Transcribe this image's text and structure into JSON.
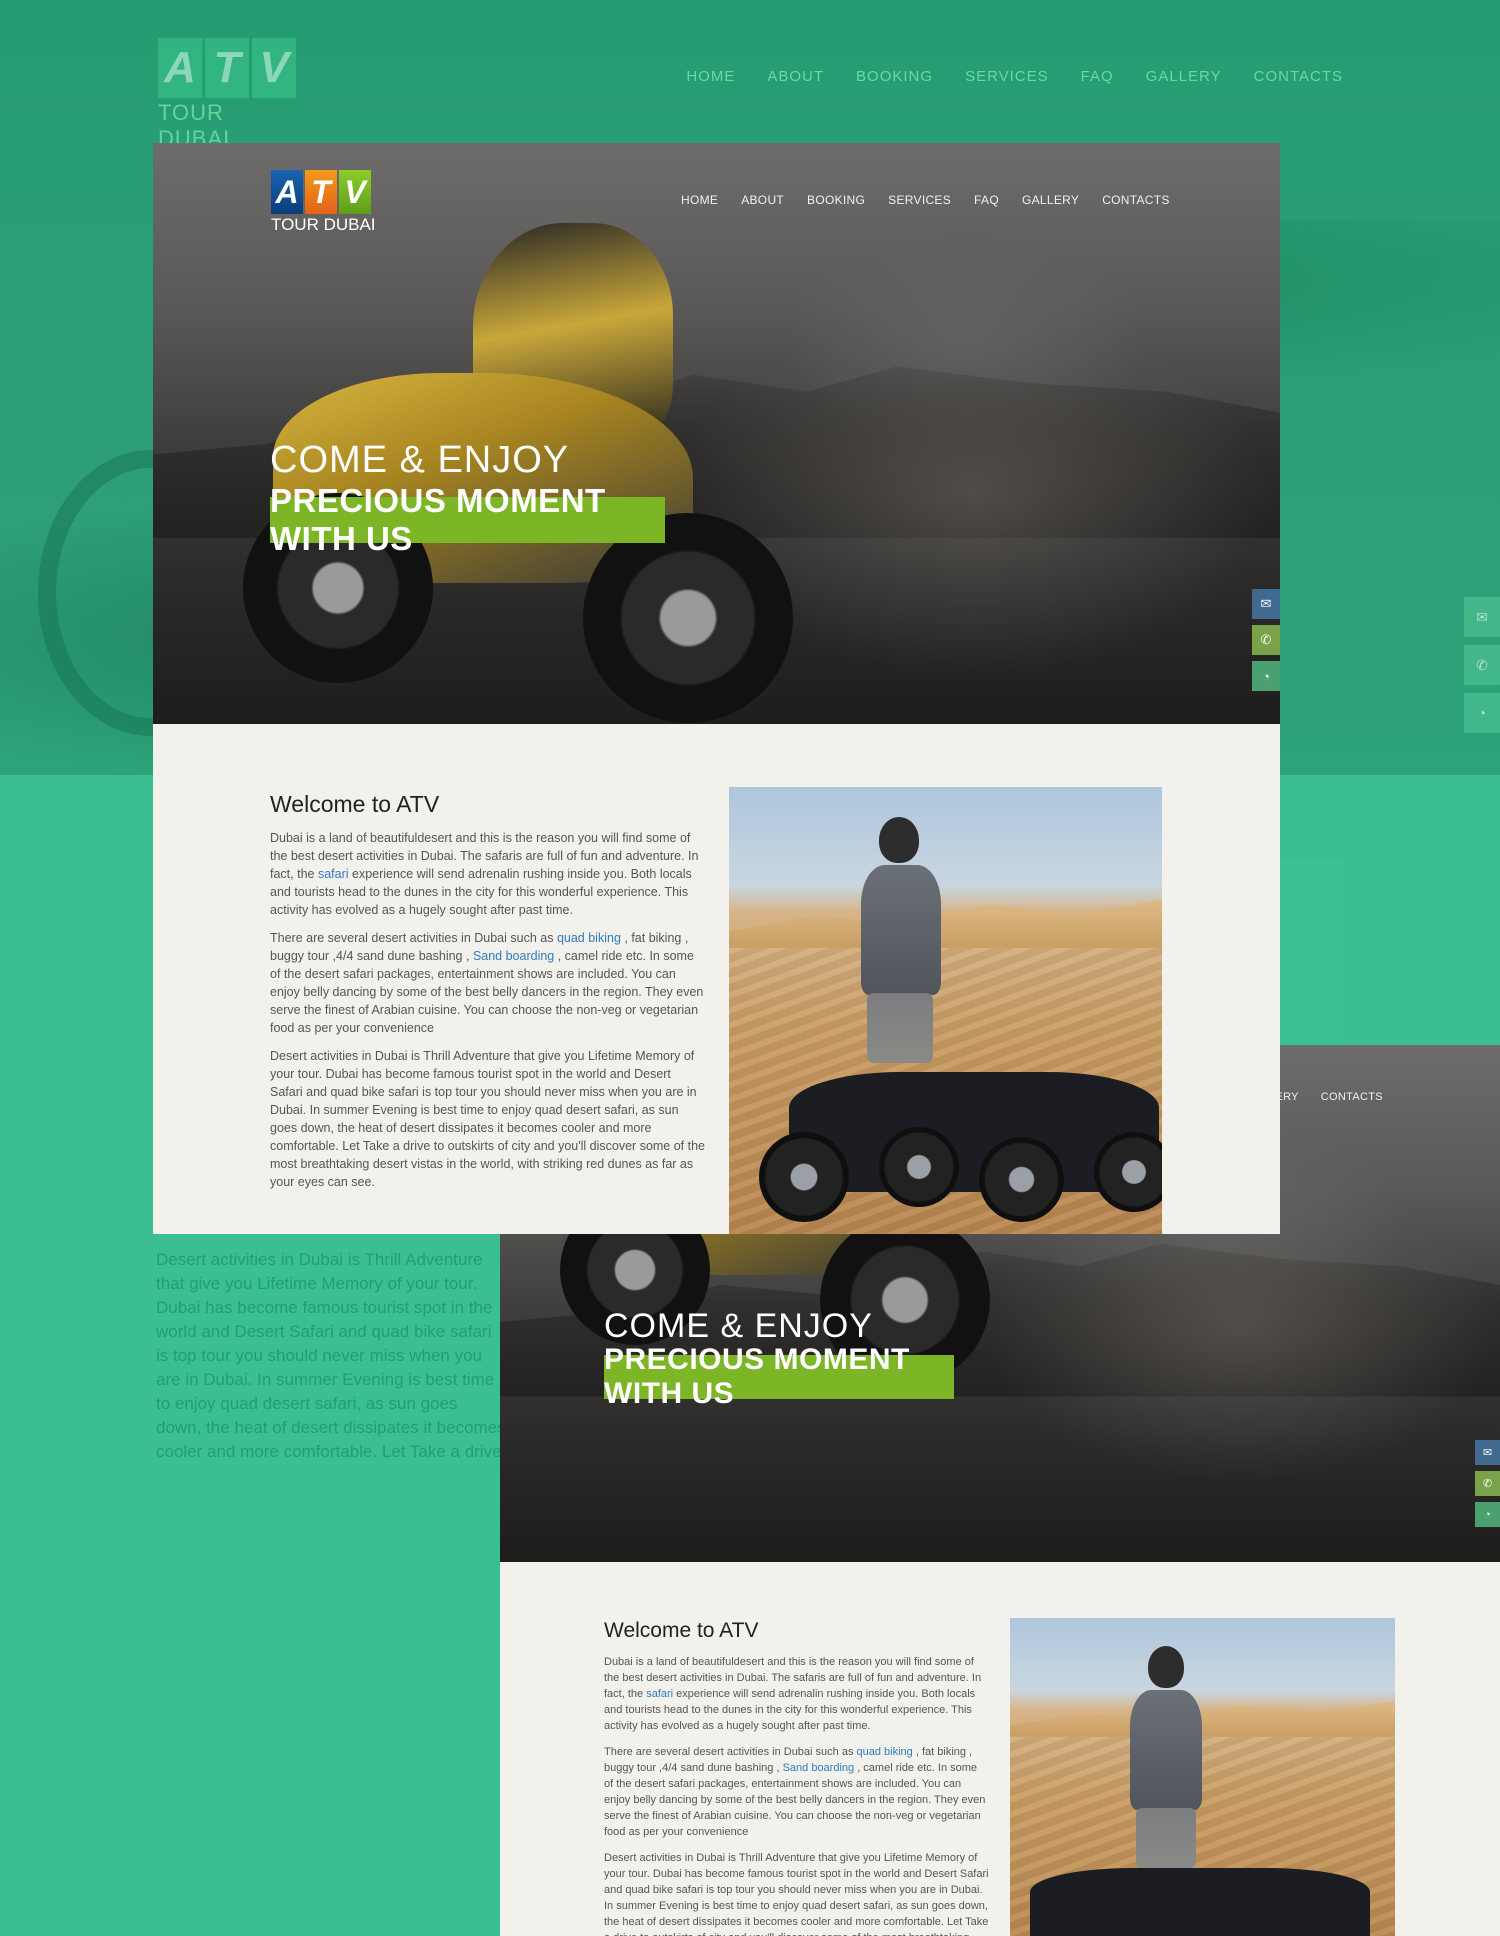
{
  "brand": {
    "letters": [
      "A",
      "T",
      "V"
    ],
    "name": "TOUR DUBAI"
  },
  "nav": {
    "items": [
      "HOME",
      "ABOUT",
      "BOOKING",
      "SERVICES",
      "FAQ",
      "GALLERY",
      "CONTACTS"
    ]
  },
  "nav_partial": {
    "gallery_fragment": "ALLERY",
    "contacts": "CONTACTS"
  },
  "hero": {
    "title": "COME & ENJOY",
    "badge": "PRECIOUS MOMENT WITH US"
  },
  "side_buttons": [
    {
      "icon": "envelope-icon",
      "glyph": "✉"
    },
    {
      "icon": "phone-icon",
      "glyph": "✆"
    },
    {
      "icon": "whatsapp-icon",
      "glyph": "◔"
    }
  ],
  "welcome": {
    "title": "Welcome to ATV",
    "p1_a": "Dubai is a land of beautifuldesert and this is the reason you will find some of the best desert activities in Dubai. The safaris are full of fun and adventure. In fact, the ",
    "p1_link": "safari",
    "p1_b": " experience will send adrenalin rushing inside you. Both locals and tourists head to the dunes in the city for this wonderful experience. This activity has evolved as a hugely sought after past time.",
    "p2_a": "There are several desert activities in Dubai such as ",
    "p2_link1": "quad biking",
    "p2_b": " , fat biking , buggy tour ,4/4 sand dune bashing , ",
    "p2_link2": "Sand boarding",
    "p2_c": " , camel ride etc. In some of the desert safari packages, entertainment shows are included. You can enjoy belly dancing by some of the best belly dancers in the region. They even serve the finest of Arabian cuisine. You can choose the non-veg or vegetarian food as per your convenience",
    "p3": "Desert activities in Dubai is Thrill Adventure that give you Lifetime Memory of your tour. Dubai has become famous tourist spot in the world and Desert Safari and quad bike safari is top tour you should never miss when you are in Dubai. In summer Evening is best time to enjoy quad desert safari, as sun goes down, the heat of desert dissipates it becomes cooler and more comfortable. Let Take a drive to outskirts of city and you'll discover some of the most breathtaking desert vistas in the world, with striking red dunes as far as your eyes can see."
  },
  "ghost_text": "Desert activities in Dubai is Thrill Adventure that give you Lifetime Memory of your tour. Dubai has become famous tourist spot in the world and Desert Safari and quad bike safari is top tour you should never miss when you are in Dubai. In summer Evening is best time to enjoy quad desert safari, as sun goes down, the heat of desert dissipates it becomes cooler and more comfortable. Let Take a drive to outskirts of city and you'll discover some of the most breathtaking desert vistas in the world, with striking red dunes as far as your eyes can see.",
  "colors": {
    "page_green": "#3cbe93",
    "badge_green": "#7cb526",
    "link_blue": "#2f7bbf"
  }
}
